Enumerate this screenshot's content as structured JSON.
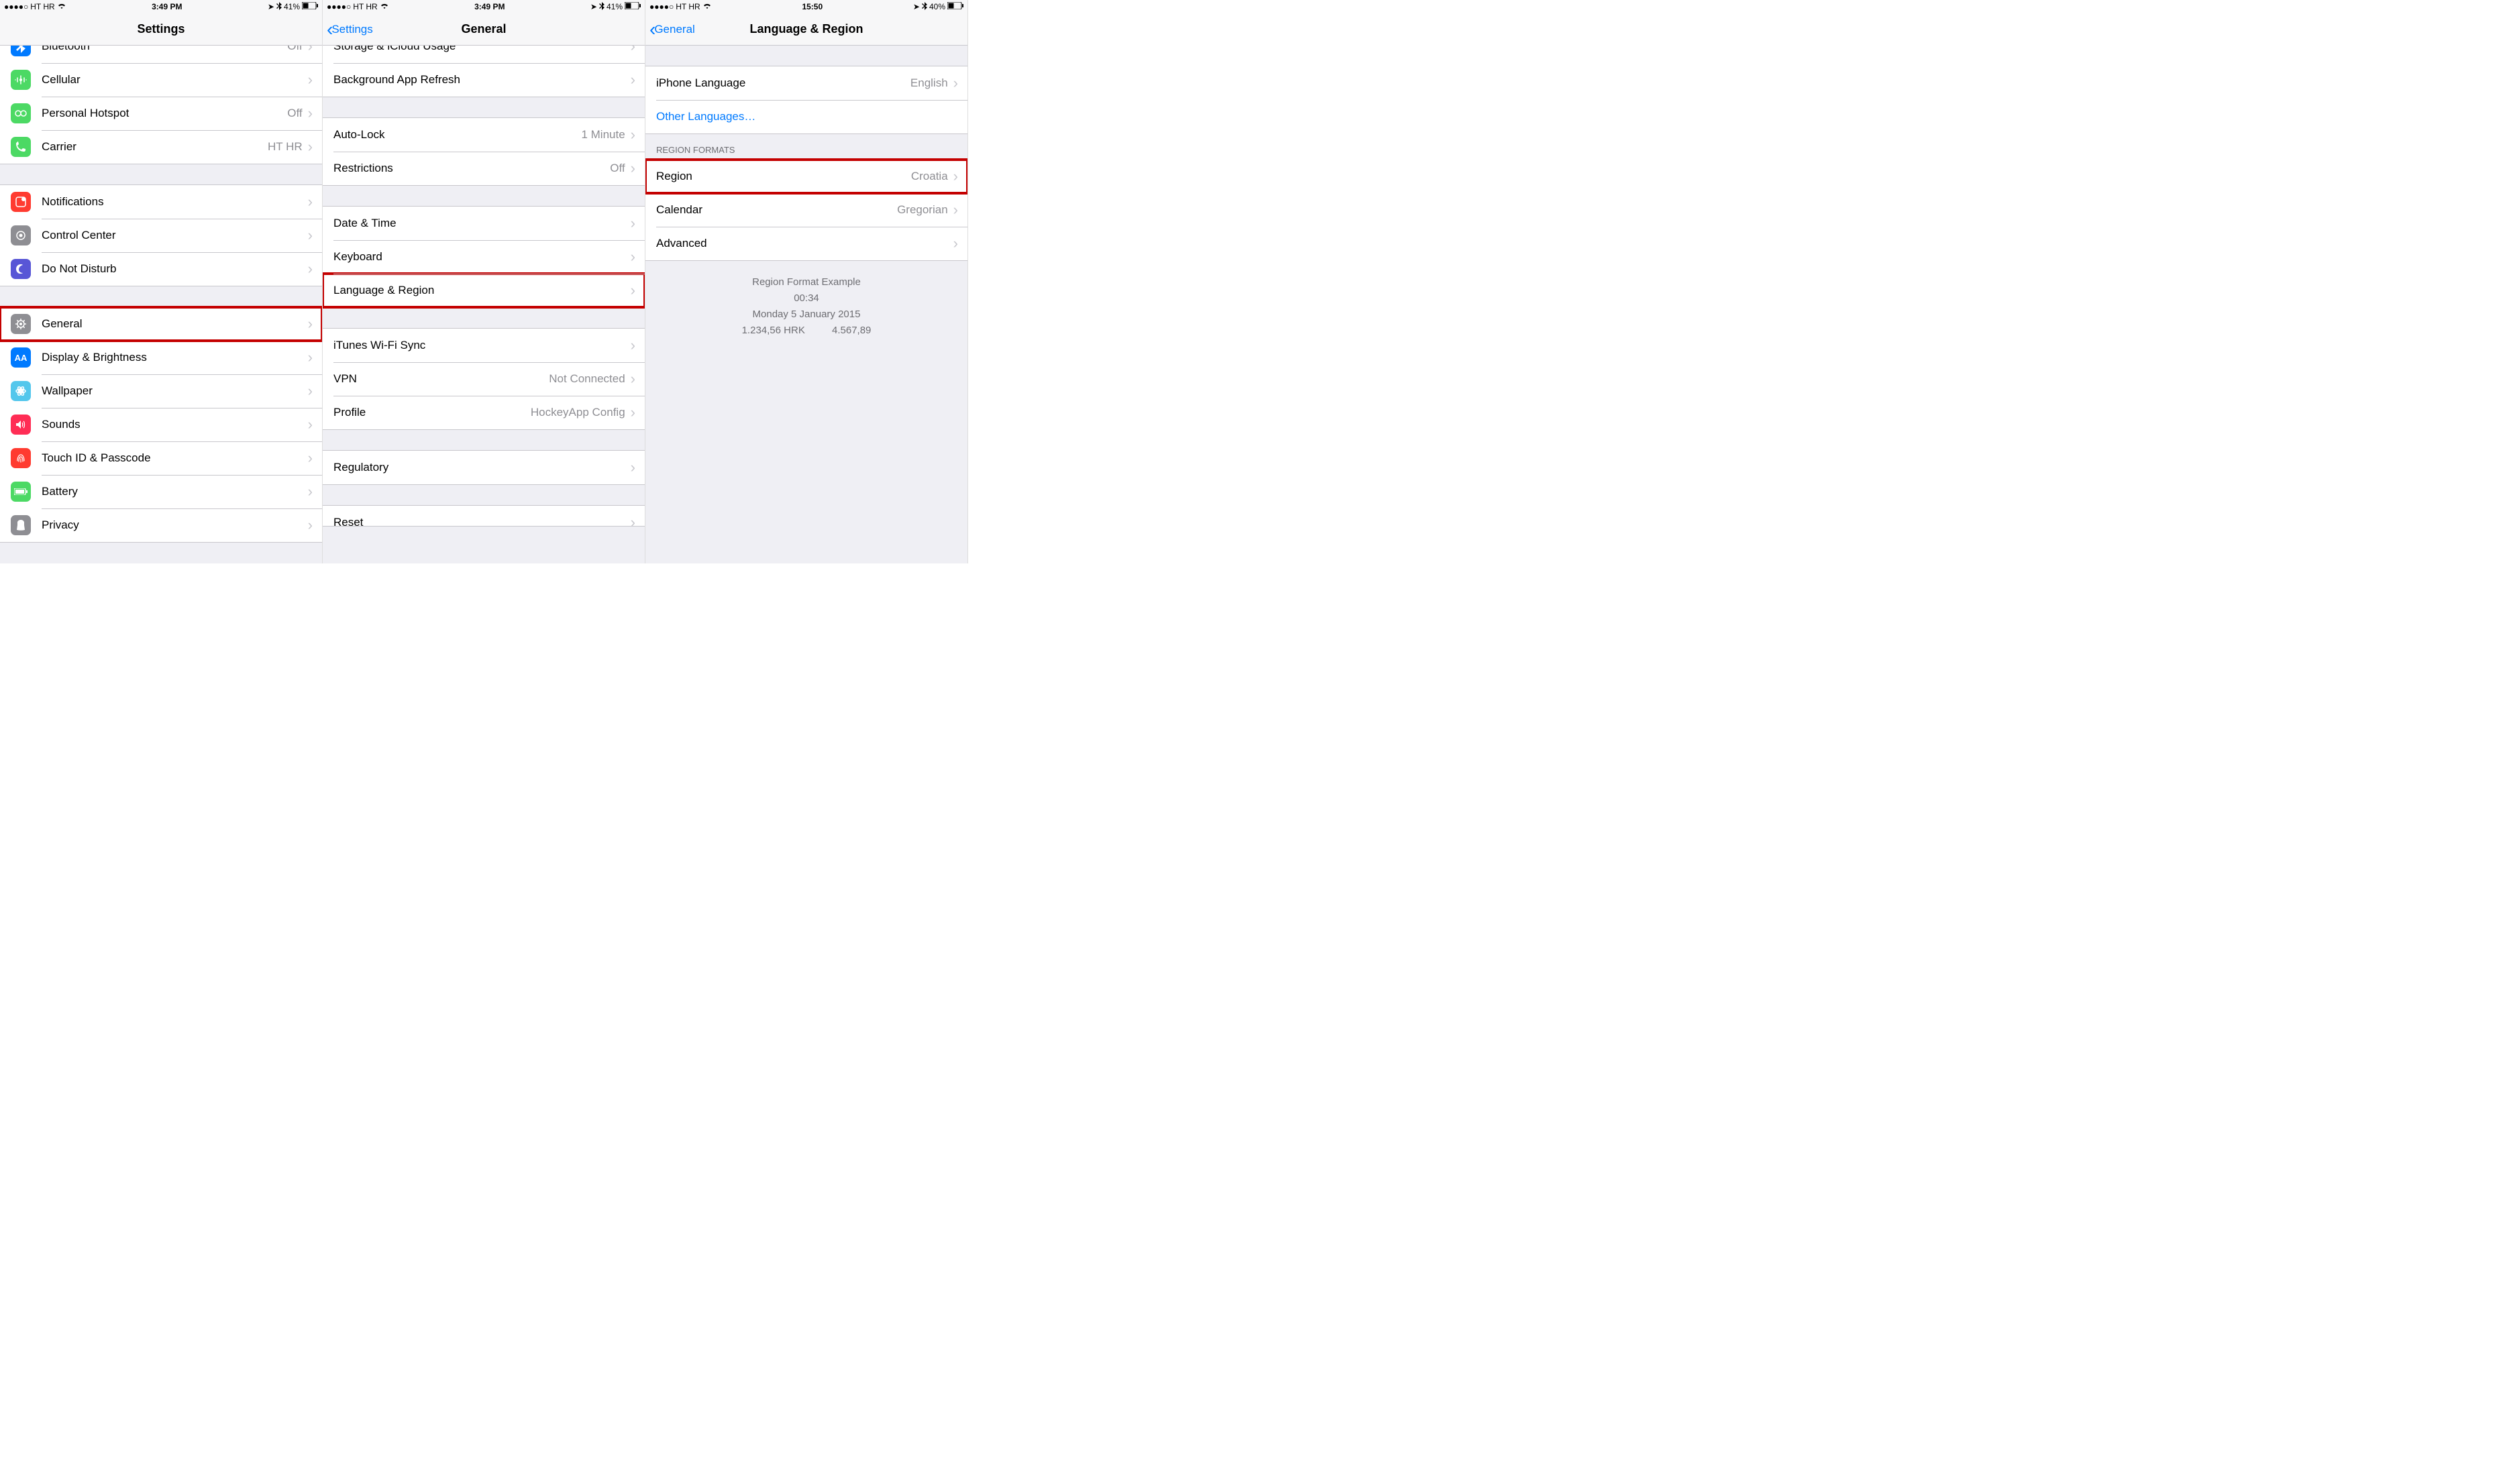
{
  "status": {
    "carrier": "HT HR",
    "time12": "3:49 PM",
    "time24": "15:50",
    "battery1": "41%",
    "battery2": "40%"
  },
  "pane1": {
    "title": "Settings",
    "rows": [
      {
        "icon": "bluetooth",
        "bg": "#007aff",
        "label": "Bluetooth",
        "value": "Off"
      },
      {
        "icon": "cellular",
        "bg": "#4cd964",
        "label": "Cellular",
        "value": ""
      },
      {
        "icon": "hotspot",
        "bg": "#4cd964",
        "label": "Personal Hotspot",
        "value": "Off"
      },
      {
        "icon": "carrier",
        "bg": "#4cd964",
        "label": "Carrier",
        "value": "HT HR"
      }
    ],
    "rows2": [
      {
        "icon": "notif",
        "bg": "#ff3b30",
        "label": "Notifications"
      },
      {
        "icon": "cc",
        "bg": "#8e8e93",
        "label": "Control Center"
      },
      {
        "icon": "dnd",
        "bg": "#5856d6",
        "label": "Do Not Disturb"
      }
    ],
    "rows3": [
      {
        "icon": "general",
        "bg": "#8e8e93",
        "label": "General",
        "hl": true
      },
      {
        "icon": "display",
        "bg": "#007aff",
        "label": "Display & Brightness"
      },
      {
        "icon": "wall",
        "bg": "#54c7ec",
        "label": "Wallpaper"
      },
      {
        "icon": "sounds",
        "bg": "#ff2d55",
        "label": "Sounds"
      },
      {
        "icon": "touchid",
        "bg": "#ff3b30",
        "label": "Touch ID & Passcode"
      },
      {
        "icon": "battery",
        "bg": "#4cd964",
        "label": "Battery"
      },
      {
        "icon": "privacy",
        "bg": "#8e8e93",
        "label": "Privacy"
      }
    ]
  },
  "pane2": {
    "back": "Settings",
    "title": "General",
    "rows_top": [
      {
        "label": "Storage & iCloud Usage"
      },
      {
        "label": "Background App Refresh"
      }
    ],
    "rows_a": [
      {
        "label": "Auto-Lock",
        "value": "1 Minute"
      },
      {
        "label": "Restrictions",
        "value": "Off"
      }
    ],
    "rows_b": [
      {
        "label": "Date & Time"
      },
      {
        "label": "Keyboard"
      },
      {
        "label": "Language & Region",
        "hl": true
      }
    ],
    "rows_c": [
      {
        "label": "iTunes Wi-Fi Sync"
      },
      {
        "label": "VPN",
        "value": "Not Connected"
      },
      {
        "label": "Profile",
        "value": "HockeyApp Config"
      }
    ],
    "rows_d": [
      {
        "label": "Regulatory"
      }
    ],
    "rows_e": [
      {
        "label": "Reset"
      }
    ]
  },
  "pane3": {
    "back": "General",
    "title": "Language & Region",
    "rows_a": [
      {
        "label": "iPhone Language",
        "value": "English"
      },
      {
        "label": "Other Languages…",
        "link": true,
        "nodisc": true
      }
    ],
    "section": "REGION FORMATS",
    "rows_b": [
      {
        "label": "Region",
        "value": "Croatia",
        "hl": true
      },
      {
        "label": "Calendar",
        "value": "Gregorian"
      },
      {
        "label": "Advanced"
      }
    ],
    "example": {
      "title": "Region Format Example",
      "time": "00:34",
      "date": "Monday 5 January 2015",
      "num1": "1.234,56 HRK",
      "num2": "4.567,89"
    }
  },
  "icons": {
    "bluetooth": "䷊",
    "cellular": "▮",
    "hotspot": "⊘",
    "carrier": "✆",
    "notif": "◻",
    "cc": "◉",
    "dnd": "☾",
    "general": "⚙",
    "display": "A",
    "wall": "❋",
    "sounds": "🔊",
    "touchid": "◉",
    "battery": "▬",
    "privacy": "✋"
  }
}
